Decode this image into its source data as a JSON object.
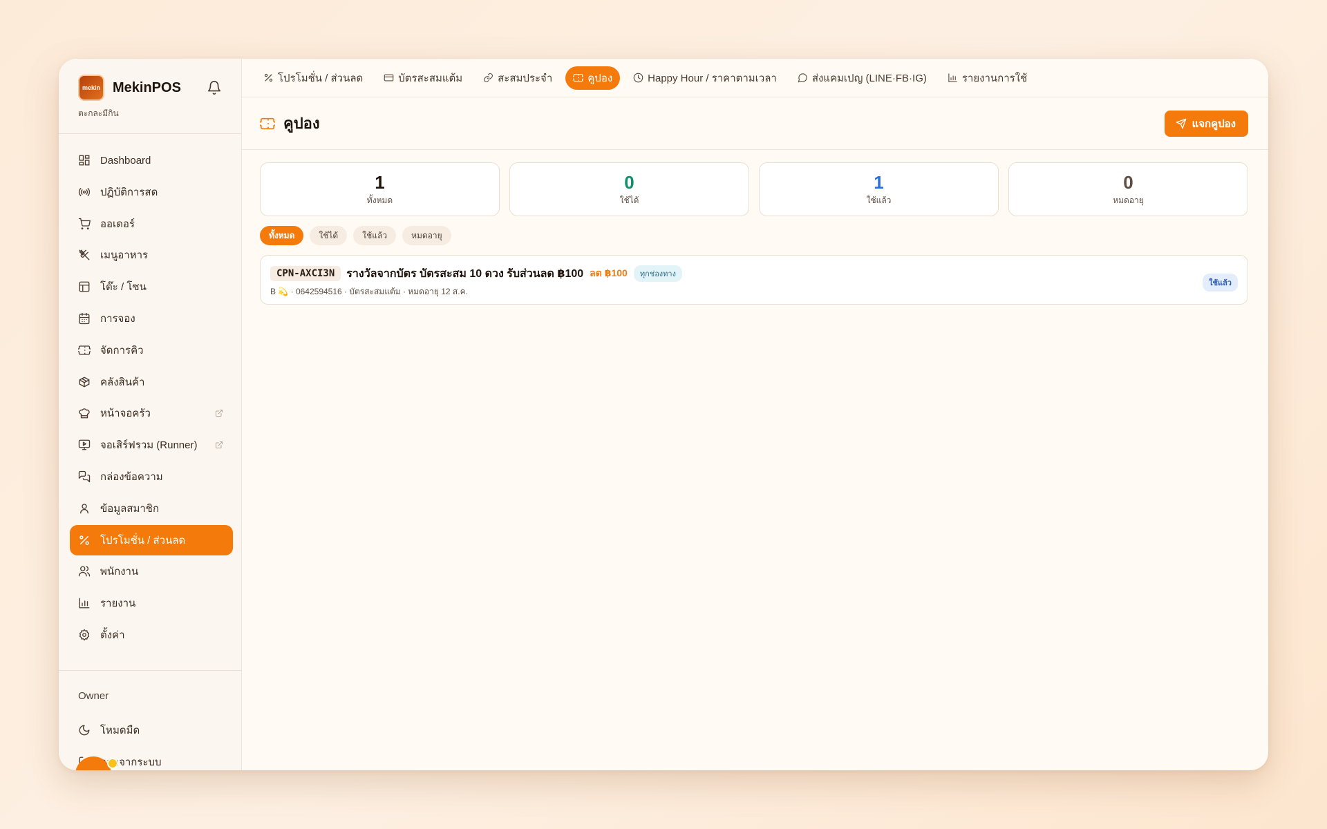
{
  "brand": {
    "name": "MekinPOS",
    "subtitle": "ตะกละมีกิน",
    "logo_text": "mekin"
  },
  "sidebar": {
    "items": [
      {
        "label": "Dashboard",
        "icon": "dashboard-icon"
      },
      {
        "label": "ปฏิบัติการสด",
        "icon": "broadcast-icon"
      },
      {
        "label": "ออเดอร์",
        "icon": "cart-icon"
      },
      {
        "label": "เมนูอาหาร",
        "icon": "utensils-icon"
      },
      {
        "label": "โต๊ะ / โซน",
        "icon": "table-icon"
      },
      {
        "label": "การจอง",
        "icon": "calendar-icon"
      },
      {
        "label": "จัดการคิว",
        "icon": "ticket-icon"
      },
      {
        "label": "คลังสินค้า",
        "icon": "package-icon"
      },
      {
        "label": "หน้าจอครัว",
        "icon": "chef-hat-icon"
      },
      {
        "label": "จอเสิร์ฟรวม (Runner)",
        "icon": "monitor-icon"
      },
      {
        "label": "กล่องข้อความ",
        "icon": "messages-icon"
      },
      {
        "label": "ข้อมูลสมาชิก",
        "icon": "user-icon"
      },
      {
        "label": "โปรโมชั่น / ส่วนลด",
        "icon": "percent-icon"
      },
      {
        "label": "พนักงาน",
        "icon": "users-icon"
      },
      {
        "label": "รายงาน",
        "icon": "bar-chart-icon"
      },
      {
        "label": "ตั้งค่า",
        "icon": "gear-icon"
      }
    ],
    "owner_label": "Owner",
    "bottom": [
      {
        "label": "โหมดมืด",
        "icon": "moon-icon"
      },
      {
        "label": "ออกจากระบบ",
        "icon": "logout-icon"
      }
    ]
  },
  "tabs": [
    {
      "label": "โปรโมชั่น / ส่วนลด",
      "icon": "percent-icon"
    },
    {
      "label": "บัตรสะสมแต้ม",
      "icon": "card-icon"
    },
    {
      "label": "สะสมประจำ",
      "icon": "link-icon"
    },
    {
      "label": "คูปอง",
      "icon": "ticket-icon"
    },
    {
      "label": "Happy Hour / ราคาตามเวลา",
      "icon": "clock-icon"
    },
    {
      "label": "ส่งแคมเปญ (LINE·FB·IG)",
      "icon": "chat-icon"
    },
    {
      "label": "รายงานการใช้",
      "icon": "bar-chart-icon"
    }
  ],
  "page": {
    "title": "คูปอง",
    "primary_button": "แจกคูปอง"
  },
  "stats": [
    {
      "value": "1",
      "label": "ทั้งหมด",
      "color": "#1f140c"
    },
    {
      "value": "0",
      "label": "ใช้ได้",
      "color": "#0f8f6a"
    },
    {
      "value": "1",
      "label": "ใช้แล้ว",
      "color": "#2d6fd8"
    },
    {
      "value": "0",
      "label": "หมดอายุ",
      "color": "#5e4d40"
    }
  ],
  "filters": [
    "ทั้งหมด",
    "ใช้ได้",
    "ใช้แล้ว",
    "หมดอายุ"
  ],
  "coupons": [
    {
      "code": "CPN-AXCI3N",
      "title": "รางวัลจากบัตร บัตรสะสม 10 ดวง รับส่วนลด ฿100",
      "discount": "ลด ฿100",
      "channel": "ทุกช่องทาง",
      "meta": "B 💫 · 0642594516 · บัตรสะสมแต้ม · หมดอายุ 12 ส.ค.",
      "status": "ใช้แล้ว"
    }
  ],
  "colors": {
    "accent": "#f57a0c",
    "background": "#fffaf4"
  }
}
